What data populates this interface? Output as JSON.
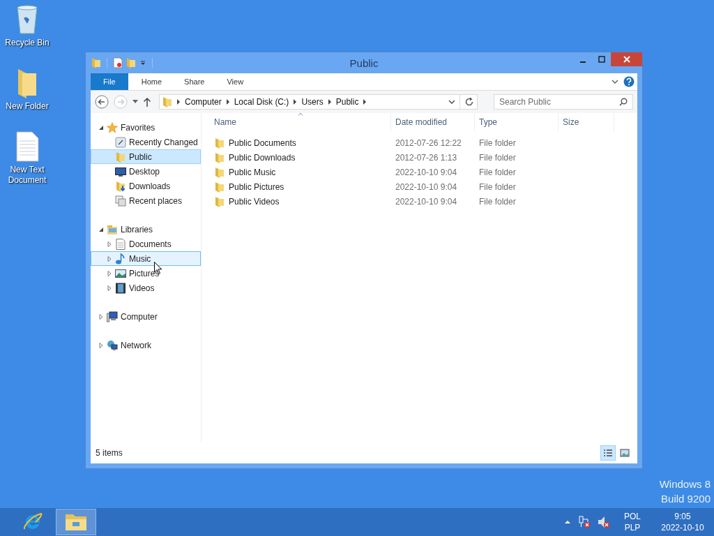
{
  "desktop_icons": [
    {
      "label": "Recycle Bin",
      "kind": "bin"
    },
    {
      "label": "New Folder",
      "kind": "folder"
    },
    {
      "label": "New Text Document",
      "kind": "text"
    }
  ],
  "window": {
    "title": "Public",
    "ribbon_tabs": [
      {
        "label": "File",
        "selected": true
      },
      {
        "label": "Home",
        "selected": false
      },
      {
        "label": "Share",
        "selected": false
      },
      {
        "label": "View",
        "selected": false
      }
    ],
    "address": [
      "Computer",
      "Local Disk (C:)",
      "Users",
      "Public"
    ],
    "search": {
      "placeholder": "Search Public"
    },
    "nav": [
      {
        "label": "Favorites",
        "kind": "star",
        "expanded": true,
        "children": [
          {
            "label": "Recently Changed",
            "kind": "recent",
            "selected": false,
            "hovered": false
          },
          {
            "label": "Public",
            "kind": "folder",
            "selected": true,
            "hovered": false
          },
          {
            "label": "Desktop",
            "kind": "desktop",
            "selected": false,
            "hovered": false
          },
          {
            "label": "Downloads",
            "kind": "downloads",
            "selected": false,
            "hovered": false
          },
          {
            "label": "Recent places",
            "kind": "places",
            "selected": false,
            "hovered": false
          }
        ]
      },
      {
        "label": "Libraries",
        "kind": "library",
        "expanded": true,
        "children": [
          {
            "label": "Documents",
            "kind": "document",
            "selected": false,
            "hovered": false,
            "expanded": false
          },
          {
            "label": "Music",
            "kind": "music",
            "selected": false,
            "hovered": true,
            "expanded": false
          },
          {
            "label": "Pictures",
            "kind": "pictures",
            "selected": false,
            "hovered": false,
            "expanded": false
          },
          {
            "label": "Videos",
            "kind": "videos",
            "selected": false,
            "hovered": false,
            "expanded": false
          }
        ]
      },
      {
        "label": "Computer",
        "kind": "computer",
        "expanded": false
      },
      {
        "label": "Network",
        "kind": "network",
        "expanded": false
      }
    ],
    "columns": [
      "Name",
      "Date modified",
      "Type",
      "Size"
    ],
    "rows": [
      {
        "name": "Public Documents",
        "date": "2012-07-26 12:22",
        "type": "File folder"
      },
      {
        "name": "Public Downloads",
        "date": "2012-07-26 1:13",
        "type": "File folder"
      },
      {
        "name": "Public Music",
        "date": "2022-10-10 9:04",
        "type": "File folder"
      },
      {
        "name": "Public Pictures",
        "date": "2022-10-10 9:04",
        "type": "File folder"
      },
      {
        "name": "Public Videos",
        "date": "2022-10-10 9:04",
        "type": "File folder"
      }
    ],
    "status": "5 items",
    "views": [
      {
        "kind": "details",
        "selected": true
      },
      {
        "kind": "large",
        "selected": false
      }
    ]
  },
  "os_label": [
    "Windows 8",
    "Build 9200"
  ],
  "tray": {
    "language": "POL",
    "layout": "PLP",
    "time": "9:05",
    "date": "2022-10-10"
  }
}
